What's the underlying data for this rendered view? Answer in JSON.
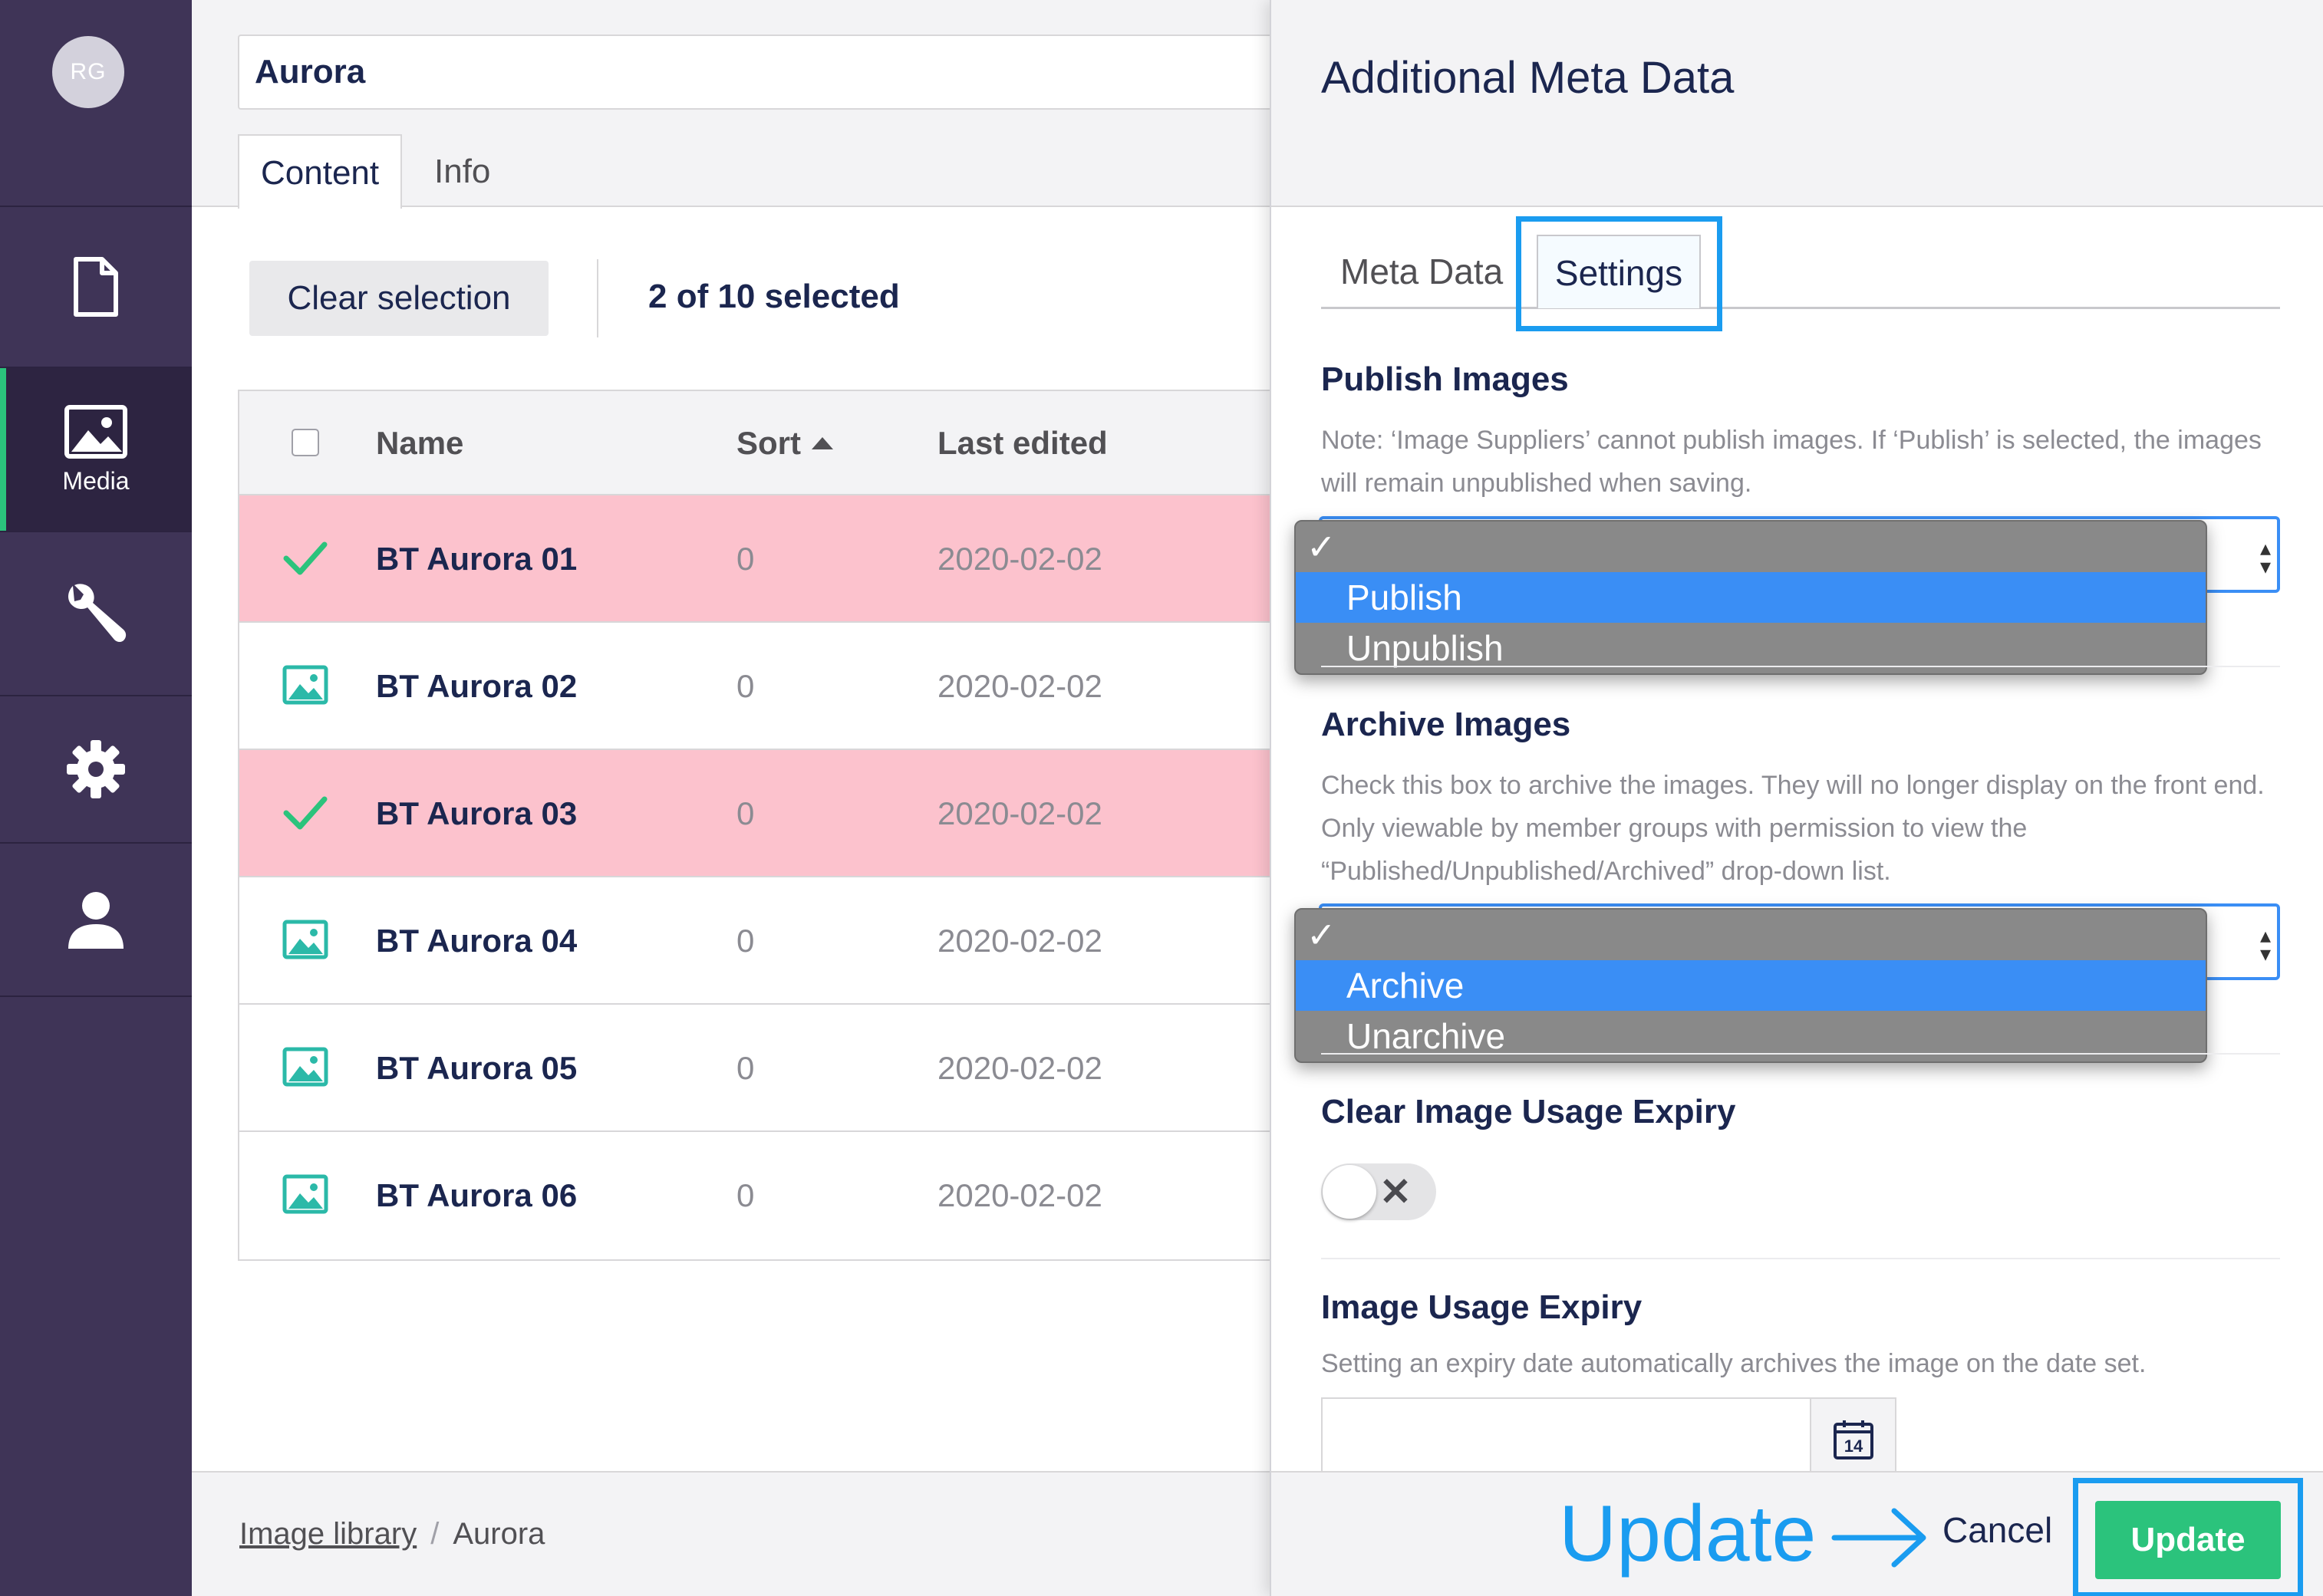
{
  "user": {
    "initials": "RG"
  },
  "nav": {
    "items": [
      {
        "name": "content",
        "icon": "document-icon",
        "label": ""
      },
      {
        "name": "media",
        "icon": "image-icon",
        "label": "Media"
      },
      {
        "name": "settings",
        "icon": "wrench-icon",
        "label": ""
      },
      {
        "name": "packages",
        "icon": "gear-icon",
        "label": ""
      },
      {
        "name": "users",
        "icon": "user-icon",
        "label": ""
      }
    ]
  },
  "editor": {
    "name_value": "Aurora",
    "tabs": [
      "Content",
      "Info"
    ],
    "toolbar": {
      "clear_label": "Clear selection",
      "selection_text": "2 of 10 selected"
    },
    "table": {
      "columns": [
        "Name",
        "Sort",
        "Last edited"
      ],
      "sort_icon": "sort-ascending-icon",
      "rows": [
        {
          "name": "BT Aurora 01",
          "sort": "0",
          "date": "2020-02-02",
          "selected": true
        },
        {
          "name": "BT Aurora 02",
          "sort": "0",
          "date": "2020-02-02",
          "selected": false
        },
        {
          "name": "BT Aurora 03",
          "sort": "0",
          "date": "2020-02-02",
          "selected": true
        },
        {
          "name": "BT Aurora 04",
          "sort": "0",
          "date": "2020-02-02",
          "selected": false
        },
        {
          "name": "BT Aurora 05",
          "sort": "0",
          "date": "2020-02-02",
          "selected": false
        },
        {
          "name": "BT Aurora 06",
          "sort": "0",
          "date": "2020-02-02",
          "selected": false
        }
      ]
    },
    "breadcrumb": {
      "root": "Image library",
      "separator": "/",
      "current": "Aurora"
    }
  },
  "panel": {
    "title": "Additional Meta Data",
    "tabs": {
      "meta": "Meta Data",
      "settings": "Settings"
    },
    "publish": {
      "title": "Publish Images",
      "desc": "Note: ‘Image Suppliers’ cannot publish images. If ‘Publish’ is selected, the images will remain unpublished when saving.",
      "options": [
        "",
        "Publish",
        "Unpublish"
      ],
      "highlighted": "Publish"
    },
    "archive": {
      "title": "Archive Images",
      "desc": "Check this box to archive the images. They will no longer display on the front end. Only viewable by member groups with permission to view the “Published/Unpublished/Archived” drop-down list.",
      "options": [
        "",
        "Archive",
        "Unarchive"
      ],
      "highlighted": "Archive"
    },
    "clear_expiry": {
      "title": "Clear Image Usage Expiry",
      "toggle_on": false
    },
    "expiry": {
      "title": "Image Usage Expiry",
      "desc": "Setting an expiry date automatically archives the image on the date set.",
      "value": "",
      "calendar_day": "14"
    },
    "footer": {
      "annotation": "Update",
      "cancel_label": "Cancel",
      "update_label": "Update"
    }
  },
  "colors": {
    "sidebar": "#3f3457",
    "accent_green": "#2bc37c",
    "selected_row": "#fcc2cd",
    "annotation_blue": "#1a9cf0",
    "dropdown_highlight": "#3a8ef5"
  }
}
